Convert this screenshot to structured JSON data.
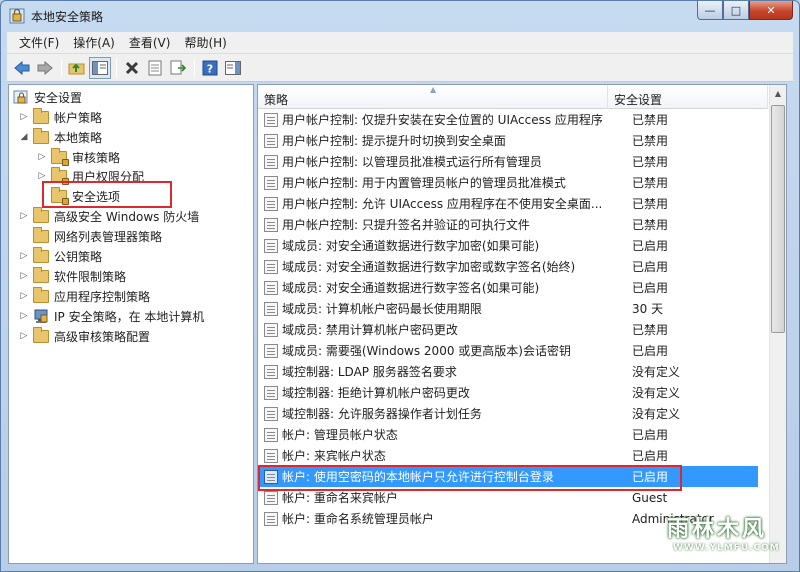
{
  "window": {
    "title": "本地安全策略"
  },
  "menu": [
    "文件(F)",
    "操作(A)",
    "查看(V)",
    "帮助(H)"
  ],
  "tree": {
    "root": "安全设置",
    "items": [
      {
        "label": "帐户策略",
        "indent": 1,
        "twisty": "closed",
        "icon": "folder"
      },
      {
        "label": "本地策略",
        "indent": 1,
        "twisty": "open",
        "icon": "folder"
      },
      {
        "label": "审核策略",
        "indent": 2,
        "twisty": "closed",
        "icon": "folder-lock"
      },
      {
        "label": "用户权限分配",
        "indent": 2,
        "twisty": "closed",
        "icon": "folder-lock"
      },
      {
        "label": "安全选项",
        "indent": 2,
        "twisty": "none",
        "icon": "folder-lock",
        "selected": true
      },
      {
        "label": "高级安全 Windows 防火墙",
        "indent": 1,
        "twisty": "closed",
        "icon": "folder"
      },
      {
        "label": "网络列表管理器策略",
        "indent": 1,
        "twisty": "none",
        "icon": "folder"
      },
      {
        "label": "公钥策略",
        "indent": 1,
        "twisty": "closed",
        "icon": "folder"
      },
      {
        "label": "软件限制策略",
        "indent": 1,
        "twisty": "closed",
        "icon": "folder"
      },
      {
        "label": "应用程序控制策略",
        "indent": 1,
        "twisty": "closed",
        "icon": "folder"
      },
      {
        "label": "IP 安全策略，在 本地计算机",
        "indent": 1,
        "twisty": "closed",
        "icon": "ip-policy"
      },
      {
        "label": "高级审核策略配置",
        "indent": 1,
        "twisty": "closed",
        "icon": "folder"
      }
    ]
  },
  "list": {
    "columns": [
      "策略",
      "安全设置"
    ],
    "rows": [
      {
        "policy": "用户帐户控制: 仅提升安装在安全位置的 UIAccess 应用程序",
        "setting": "已禁用"
      },
      {
        "policy": "用户帐户控制: 提示提升时切换到安全桌面",
        "setting": "已禁用"
      },
      {
        "policy": "用户帐户控制: 以管理员批准模式运行所有管理员",
        "setting": "已禁用"
      },
      {
        "policy": "用户帐户控制: 用于内置管理员帐户的管理员批准模式",
        "setting": "已禁用"
      },
      {
        "policy": "用户帐户控制: 允许 UIAccess 应用程序在不使用安全桌面...",
        "setting": "已禁用"
      },
      {
        "policy": "用户帐户控制: 只提升签名并验证的可执行文件",
        "setting": "已禁用"
      },
      {
        "policy": "域成员: 对安全通道数据进行数字加密(如果可能)",
        "setting": "已启用"
      },
      {
        "policy": "域成员: 对安全通道数据进行数字加密或数字签名(始终)",
        "setting": "已启用"
      },
      {
        "policy": "域成员: 对安全通道数据进行数字签名(如果可能)",
        "setting": "已启用"
      },
      {
        "policy": "域成员: 计算机帐户密码最长使用期限",
        "setting": "30 天"
      },
      {
        "policy": "域成员: 禁用计算机帐户密码更改",
        "setting": "已禁用"
      },
      {
        "policy": "域成员: 需要强(Windows 2000 或更高版本)会话密钥",
        "setting": "已启用"
      },
      {
        "policy": "域控制器: LDAP 服务器签名要求",
        "setting": "没有定义"
      },
      {
        "policy": "域控制器: 拒绝计算机帐户密码更改",
        "setting": "没有定义"
      },
      {
        "policy": "域控制器: 允许服务器操作者计划任务",
        "setting": "没有定义"
      },
      {
        "policy": "帐户: 管理员帐户状态",
        "setting": "已启用"
      },
      {
        "policy": "帐户: 来宾帐户状态",
        "setting": "已启用"
      },
      {
        "policy": "帐户: 使用空密码的本地帐户只允许进行控制台登录",
        "setting": "已启用",
        "selected": true
      },
      {
        "policy": "帐户: 重命名来宾帐户",
        "setting": "Guest"
      },
      {
        "policy": "帐户: 重命名系统管理员帐户",
        "setting": "Administrator"
      }
    ]
  },
  "watermark": {
    "brand": "雨林木风",
    "url": "WWW.YLMFU.COM"
  },
  "colors": {
    "selection": "#3399ff",
    "highlight_box": "#e0262f",
    "folder": "#e8c56d"
  }
}
